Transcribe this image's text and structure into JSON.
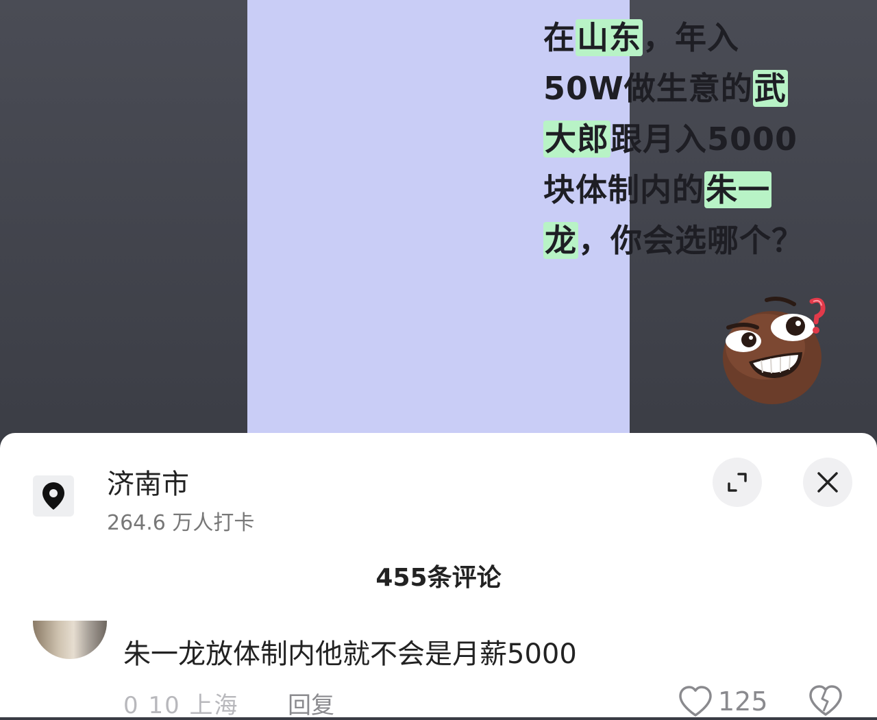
{
  "video": {
    "headline_lines": [
      [
        {
          "t": "在",
          "h": false
        },
        {
          "t": "山东",
          "h": true
        },
        {
          "t": "，年入",
          "h": false
        }
      ],
      [
        {
          "t": "50W做生意的",
          "h": false
        },
        {
          "t": "武",
          "h": true
        }
      ],
      [
        {
          "t": "大郎",
          "h": true
        },
        {
          "t": "跟月入5000",
          "h": false
        }
      ],
      [
        {
          "t": "块体制内的",
          "h": false
        },
        {
          "t": "朱一",
          "h": true
        }
      ],
      [
        {
          "t": "龙",
          "h": true
        },
        {
          "t": "，你会选哪个？",
          "h": false
        }
      ]
    ],
    "emoji_icon": "thinking-grin-question-emoji"
  },
  "location": {
    "icon": "location-pin-icon",
    "name": "济南市",
    "checkins": "264.6 万人打卡"
  },
  "controls": {
    "expand_icon": "expand-icon",
    "close_icon": "close-icon"
  },
  "comments": {
    "count_label": "455条评论",
    "items": [
      {
        "text": "朱一龙放体制内他就不会是月薪5000",
        "meta": "0 10 上海",
        "reply_label": "回复",
        "likes": "125"
      }
    ]
  },
  "colors": {
    "highlight": "#b8f3c6",
    "video_bg": "#c9cdf6",
    "text_dark": "#222222",
    "text_muted": "#8a8a8e"
  }
}
